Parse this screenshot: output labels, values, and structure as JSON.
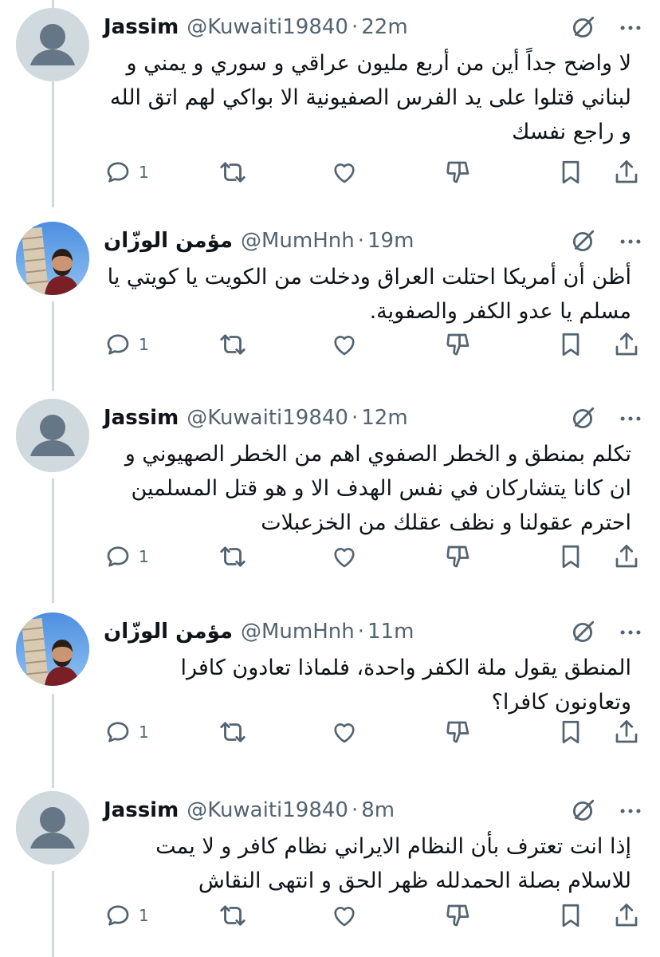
{
  "tweets": [
    {
      "name": "Jassim",
      "handle": "@Kuwaiti19840",
      "separator": "·",
      "time": "22m",
      "avatar": "default-avatar",
      "text": "لا واضح جداً أين من أربع مليون عراقي و سوري و يمني و لبناني قتلوا على يد الفرس الصفيونية الا بواكي لهم اتق الله و راجع نفسك",
      "reply_count": "1"
    },
    {
      "name": "مؤمن الوزّان",
      "handle": "@MumHnh",
      "separator": "·",
      "time": "19m",
      "avatar": "photo-avatar",
      "text": "أظن أن أمريكا احتلت العراق ودخلت من الكويت يا كويتي يا مسلم يا عدو الكفر والصفوية.",
      "reply_count": "1"
    },
    {
      "name": "Jassim",
      "handle": "@Kuwaiti19840",
      "separator": "·",
      "time": "12m",
      "avatar": "default-avatar",
      "text": "تكلم بمنطق و الخطر الصفوي اهم من الخطر الصهيوني و ان كانا يتشاركان في نفس الهدف الا و هو قتل المسلمين احترم عقولنا و نظف عقلك من الخزعبلات",
      "reply_count": "1"
    },
    {
      "name": "مؤمن الوزّان",
      "handle": "@MumHnh",
      "separator": "·",
      "time": "11m",
      "avatar": "photo-avatar",
      "text": "المنطق يقول ملة الكفر واحدة، فلماذا تعادون كافرا وتعاونون كافرا؟",
      "reply_count": "1"
    },
    {
      "name": "Jassim",
      "handle": "@Kuwaiti19840",
      "separator": "·",
      "time": "8m",
      "avatar": "default-avatar",
      "text": "إذا انت تعترف بأن النظام الايراني نظام كافر و لا يمت للاسلام بصلة الحمدلله ظهر الحق و انتهى النقاش",
      "reply_count": "1"
    }
  ],
  "colors": {
    "text": "#0f1419",
    "secondary": "#536471",
    "thread_line": "#cfd9de"
  },
  "icons": [
    "grok-icon",
    "more-icon",
    "reply-icon",
    "retweet-icon",
    "like-icon",
    "downvote-icon",
    "bookmark-icon",
    "share-icon"
  ]
}
